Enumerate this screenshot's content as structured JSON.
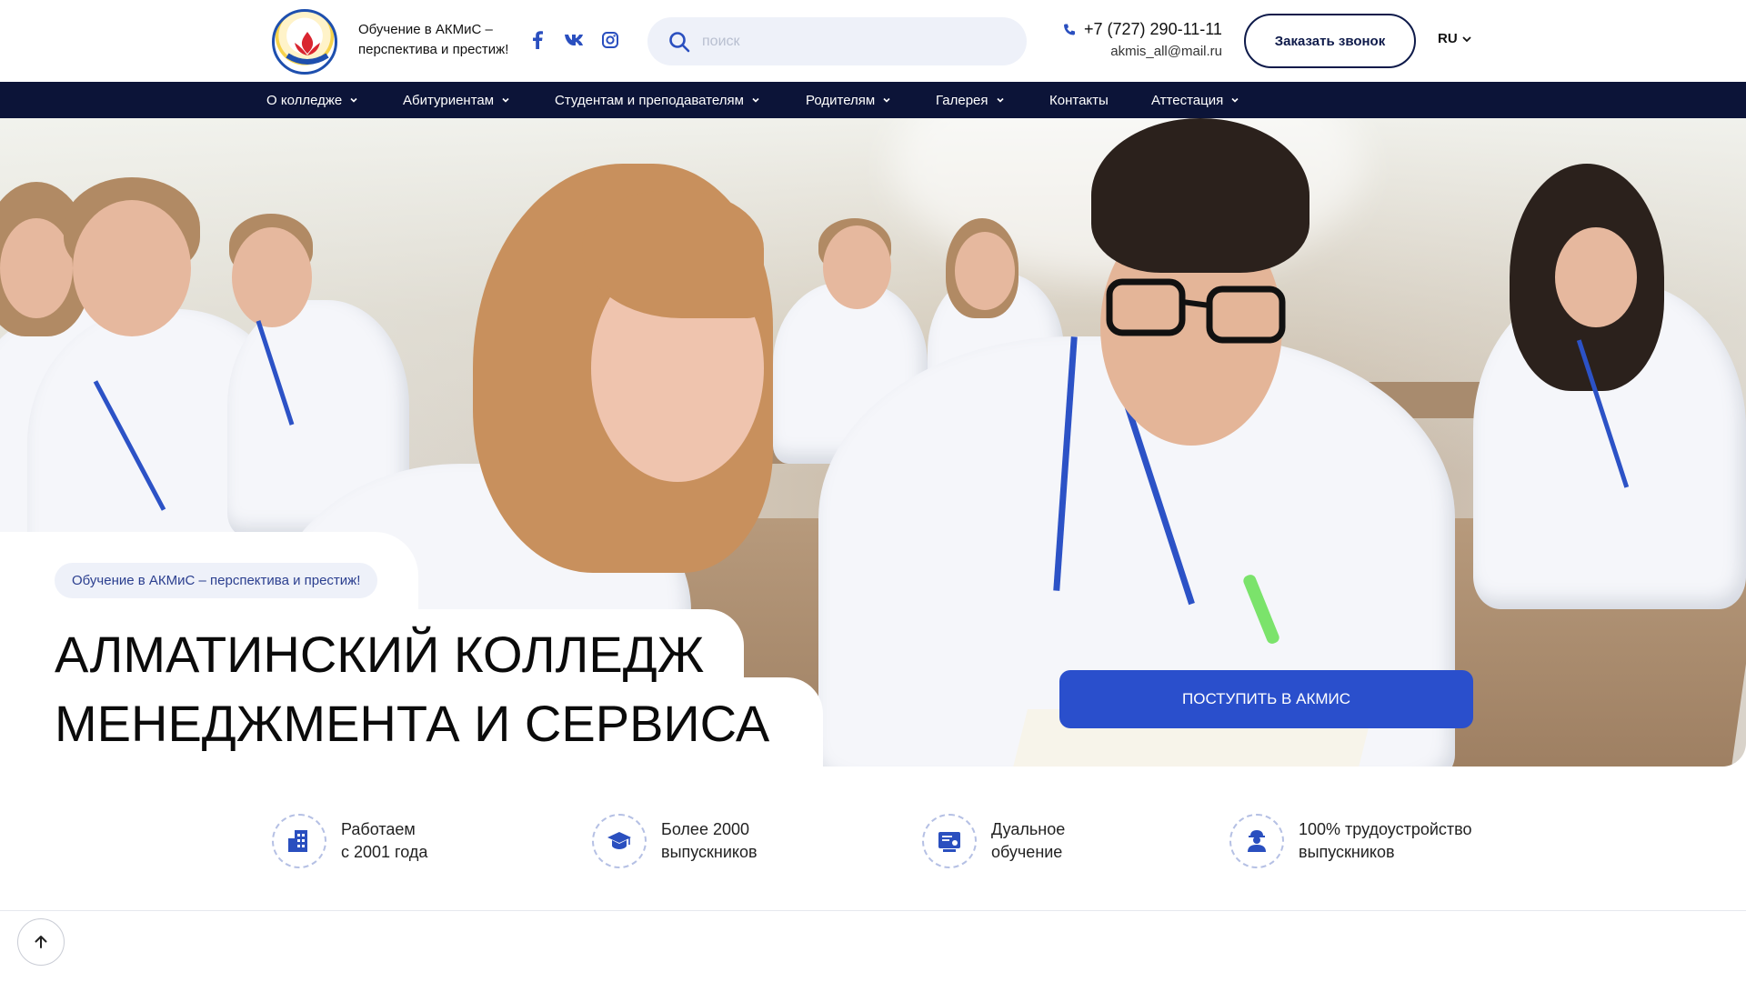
{
  "header": {
    "logo_alt": "АКМиС",
    "tagline": "Обучение в АКМиС – перспектива и престиж!",
    "social": [
      {
        "name": "facebook-icon",
        "glyph": "f"
      },
      {
        "name": "vk-icon",
        "glyph": "vk"
      },
      {
        "name": "instagram-icon",
        "glyph": ""
      }
    ],
    "search_placeholder": "поиск",
    "phone": "+7 (727) 290-11-11",
    "email": "akmis_all@mail.ru",
    "callback_label": "Заказать звонок",
    "language": "RU"
  },
  "nav": {
    "items": [
      {
        "label": "О колледже",
        "dropdown": true
      },
      {
        "label": "Абитуриентам",
        "dropdown": true
      },
      {
        "label": "Студентам и преподавателям",
        "dropdown": true
      },
      {
        "label": "Родителям",
        "dropdown": true
      },
      {
        "label": "Галерея",
        "dropdown": true
      },
      {
        "label": "Контакты",
        "dropdown": false
      },
      {
        "label": "Аттестация",
        "dropdown": true
      }
    ]
  },
  "hero": {
    "badge": "Обучение в АКМиС – перспектива и престиж!",
    "title_line1": "АЛМАТИНСКИЙ КОЛЛЕДЖ",
    "title_line2": "МЕНЕДЖМЕНТА И СЕРВИСА",
    "apply_label": "ПОСТУПИТЬ В АКМИС"
  },
  "features": [
    {
      "icon": "building-icon",
      "text": "Работаем\nс 2001 года"
    },
    {
      "icon": "graduation-cap-icon",
      "text": "Более 2000\nвыпускников"
    },
    {
      "icon": "certificate-icon",
      "text": "Дуальное\nобучение"
    },
    {
      "icon": "worker-icon",
      "text": "100% трудоустройство\nвыпускников"
    }
  ],
  "colors": {
    "brand_navy": "#0c1438",
    "accent_blue": "#2a4fcc",
    "light_bg": "#eef1f9"
  }
}
